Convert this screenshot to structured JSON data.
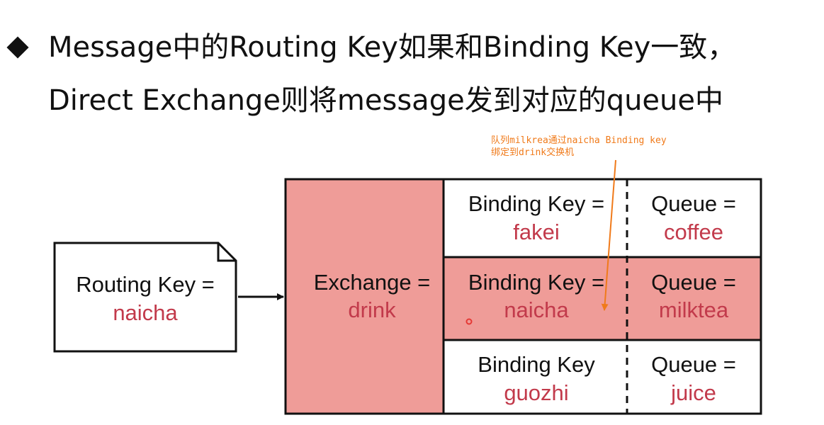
{
  "title": {
    "line1": "Message中的Routing Key如果和Binding Key一致，",
    "line2": "Direct Exchange则将message发到对应的queue中"
  },
  "annotation": {
    "line1": "队列milkrea通过naicha Binding key",
    "line2": "绑定到drink交换机"
  },
  "message": {
    "label": "Routing Key =",
    "value": "naicha"
  },
  "exchange": {
    "label": "Exchange =",
    "value": "drink"
  },
  "bindings": [
    {
      "binding_label": "Binding Key =",
      "binding_value": "fakei",
      "queue_label": "Queue =",
      "queue_value": "coffee",
      "highlighted": false
    },
    {
      "binding_label": "Binding Key =",
      "binding_value": "naicha",
      "queue_label": "Queue =",
      "queue_value": "milktea",
      "highlighted": true
    },
    {
      "binding_label": "Binding Key",
      "binding_value": "guozhi",
      "queue_label": "Queue =",
      "queue_value": "juice",
      "highlighted": false
    }
  ],
  "colors": {
    "highlight_fill": "#ef9c98",
    "value_text": "#c23a4b",
    "annotation": "#f07a1a",
    "line": "#111111"
  }
}
